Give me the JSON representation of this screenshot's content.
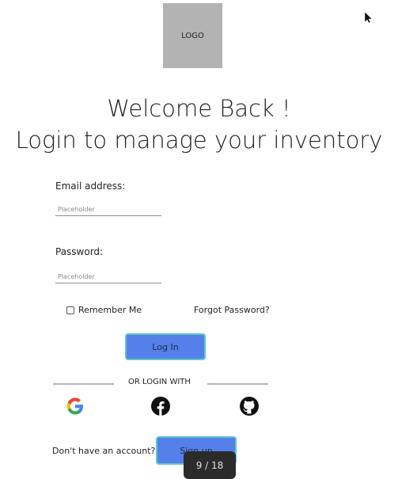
{
  "logo": {
    "text": "LOGO"
  },
  "heading": {
    "line1": "Welcome Back !",
    "line2": "Login to manage your inventory"
  },
  "form": {
    "email_label": "Email address:",
    "email_placeholder": "Placeholder",
    "password_label": "Password:",
    "password_placeholder": "Placeholder",
    "remember_label": "Remember Me",
    "forgot_label": "Forgot Password?",
    "login_button": "Log In"
  },
  "social": {
    "divider_text": "OR LOGIN WITH",
    "providers": [
      "google-icon",
      "facebook-icon",
      "github-icon"
    ]
  },
  "signup": {
    "prompt": "Don't have an account?",
    "button": "Sign up"
  },
  "viewer": {
    "page_indicator": "9 / 18"
  },
  "colors": {
    "button_bg": "#5580e9",
    "button_border": "#5cc7c7",
    "logo_bg": "#b3b3b3"
  }
}
